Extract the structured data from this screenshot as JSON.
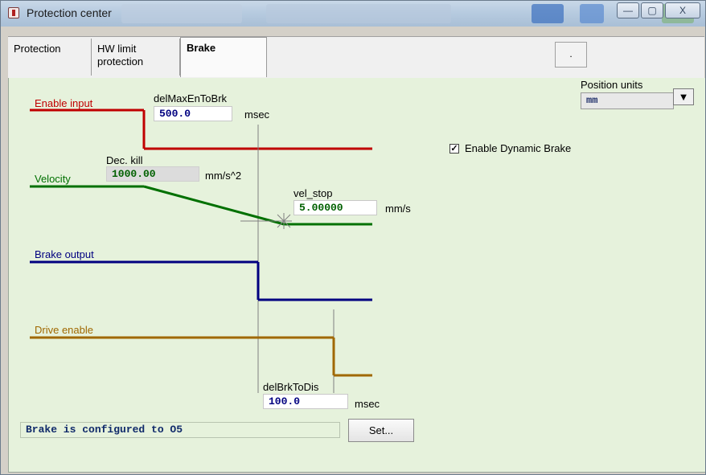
{
  "window": {
    "title": "Protection center"
  },
  "titlebar_buttons": {
    "minimize": "—",
    "maximize": "▢",
    "close": "X"
  },
  "tabs": [
    {
      "label": "Protection"
    },
    {
      "label": "HW limit\nprotection"
    },
    {
      "label": "Brake"
    }
  ],
  "tab_button": {
    "label": "."
  },
  "position_units": {
    "label": "Position units",
    "value": "mm",
    "dropdown_glyph": "▼"
  },
  "dynamic_brake": {
    "label": "Enable Dynamic Brake",
    "checked": true,
    "check_glyph": "✓"
  },
  "signals": {
    "enable_input": {
      "label": "Enable input",
      "color": "#c00000"
    },
    "velocity": {
      "label": "Velocity",
      "color": "#007000"
    },
    "brake_output": {
      "label": "Brake output",
      "color": "#000080"
    },
    "drive_enable": {
      "label": "Drive enable",
      "color": "#a06800"
    }
  },
  "params": {
    "delMaxEnToBrk": {
      "label": "delMaxEnToBrk",
      "value": "500.0",
      "unit": "msec",
      "color": "#000080"
    },
    "dec_kill": {
      "label": "Dec. kill",
      "value": "1000.00",
      "unit": "mm/s^2",
      "color": "#006000"
    },
    "vel_stop": {
      "label": "vel_stop",
      "value": "5.00000",
      "unit": "mm/s",
      "color": "#006000"
    },
    "delBrkToDis": {
      "label": "delBrkToDis",
      "value": "100.0",
      "unit": "msec",
      "color": "#000080"
    }
  },
  "status": {
    "text": "Brake is configured to O5"
  },
  "set_button": {
    "label": "Set..."
  }
}
